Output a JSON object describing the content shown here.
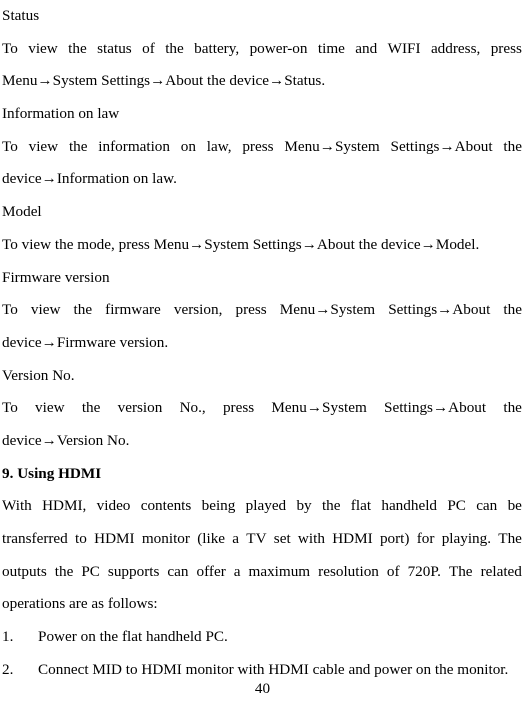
{
  "document": {
    "page_number": "40",
    "blocks": [
      {
        "kind": "heading-plain",
        "lines": [
          "Status"
        ]
      },
      {
        "kind": "paragraph-justified",
        "lines": [
          [
            "To",
            "view",
            "the",
            "status",
            "of",
            "the",
            "battery,",
            "power-on",
            "time",
            "and",
            "WIFI",
            "address,",
            "press"
          ],
          [
            "Menu→System Settings→About the device→Status."
          ]
        ]
      },
      {
        "kind": "heading-plain",
        "lines": [
          "Information on law"
        ]
      },
      {
        "kind": "paragraph-justified",
        "lines": [
          [
            "To",
            "view",
            "the",
            "information",
            "on",
            "law,",
            "press",
            "Menu→System",
            "Settings→About",
            "the"
          ],
          [
            "device→Information on law."
          ]
        ]
      },
      {
        "kind": "heading-plain",
        "lines": [
          "Model"
        ]
      },
      {
        "kind": "paragraph-plain",
        "lines": [
          "To view the mode, press Menu→System Settings→About the device→Model."
        ]
      },
      {
        "kind": "heading-plain",
        "lines": [
          "Firmware version"
        ]
      },
      {
        "kind": "paragraph-justified",
        "lines": [
          [
            "To",
            "view",
            "the",
            "firmware",
            "version,",
            "press",
            "Menu→System",
            "Settings→About",
            "the"
          ],
          [
            "device→Firmware version."
          ]
        ]
      },
      {
        "kind": "heading-plain",
        "lines": [
          "Version No."
        ]
      },
      {
        "kind": "paragraph-justified",
        "lines": [
          [
            "To",
            "view",
            "the",
            "version",
            "No.,",
            "press",
            "Menu→System",
            "Settings→About",
            "the"
          ],
          [
            "device→Version No."
          ]
        ]
      },
      {
        "kind": "heading-bold",
        "lines": [
          "9. Using HDMI"
        ]
      },
      {
        "kind": "paragraph-justified",
        "lines": [
          [
            "With",
            "HDMI,",
            "video",
            "contents",
            "being",
            "played",
            "by",
            "the",
            "flat",
            "handheld",
            "PC",
            "can",
            "be"
          ],
          [
            "transferred",
            "to",
            "HDMI",
            "monitor",
            "(like",
            "a",
            "TV",
            "set",
            "with",
            "HDMI",
            "port)",
            "for",
            "playing.",
            "The"
          ],
          [
            "outputs",
            "the",
            "PC",
            "supports",
            "can",
            "offer",
            "a",
            "maximum",
            "resolution",
            "of",
            "720P.",
            "The",
            "related"
          ],
          [
            "operations are as follows:"
          ]
        ]
      },
      {
        "kind": "numbered-item",
        "number": "1.",
        "text": "Power on the flat handheld PC."
      },
      {
        "kind": "numbered-item",
        "number": "2.",
        "text": "Connect MID to HDMI monitor with HDMI cable and power on the monitor."
      }
    ]
  }
}
